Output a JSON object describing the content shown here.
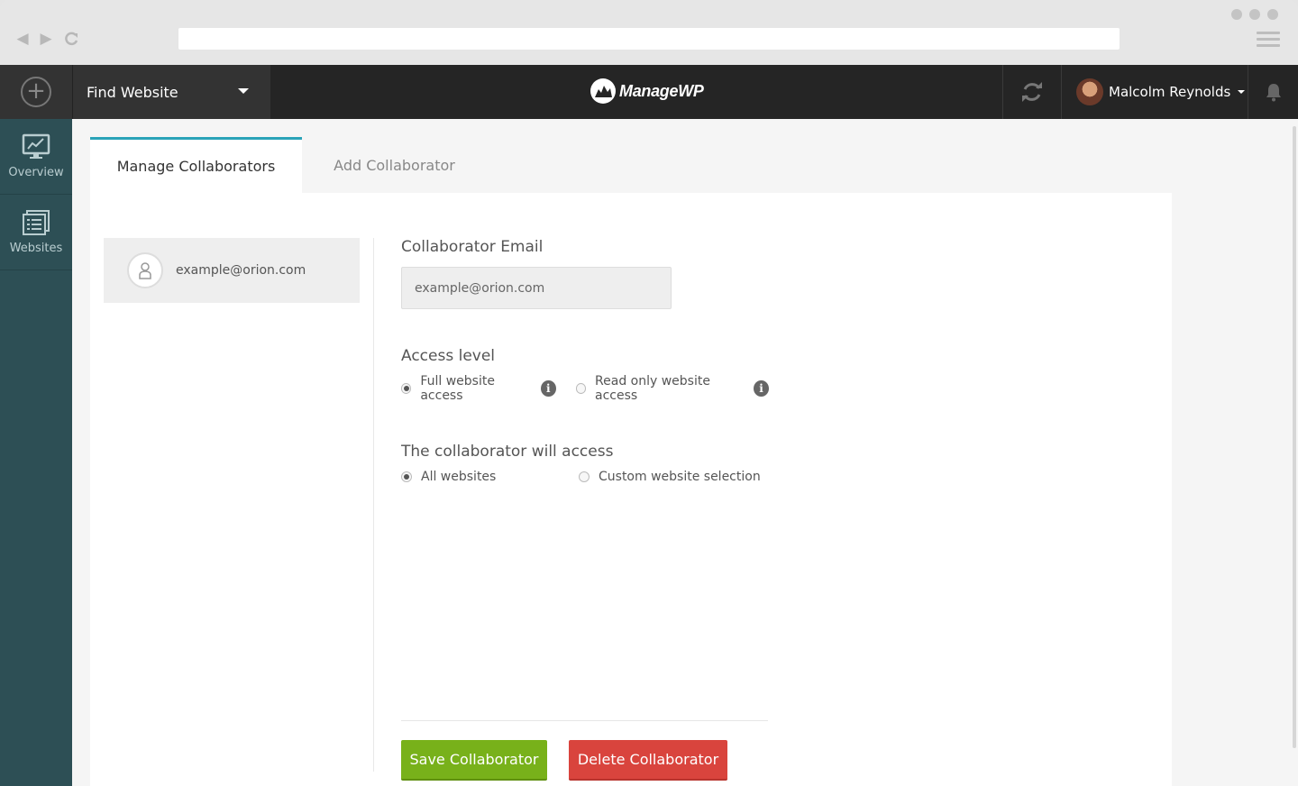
{
  "topbar": {
    "find_website_label": "Find Website",
    "logo_text": "ManageWP",
    "user_name": "Malcolm Reynolds"
  },
  "sidebar": {
    "items": [
      {
        "label": "Overview",
        "icon": "monitor-chart-icon"
      },
      {
        "label": "Websites",
        "icon": "websites-list-icon"
      }
    ]
  },
  "tabs": [
    {
      "label": "Manage Collaborators",
      "active": true
    },
    {
      "label": "Add Collaborator",
      "active": false
    }
  ],
  "collaborators": [
    {
      "email": "example@orion.com"
    }
  ],
  "form": {
    "email_label": "Collaborator Email",
    "email_value": "example@orion.com",
    "access_label": "Access level",
    "access_options": [
      {
        "label": "Full website access",
        "checked": true
      },
      {
        "label": "Read only website access",
        "checked": false
      }
    ],
    "scope_label": "The collaborator will access",
    "scope_options": [
      {
        "label": "All websites",
        "checked": true
      },
      {
        "label": "Custom website selection",
        "checked": false
      }
    ]
  },
  "buttons": {
    "save": "Save Collaborator",
    "delete": "Delete Collaborator"
  },
  "colors": {
    "accent": "#2aa3b8",
    "save": "#78b11a",
    "delete": "#d9443d",
    "sidebar": "#2d4f55",
    "topbar": "#252525"
  }
}
